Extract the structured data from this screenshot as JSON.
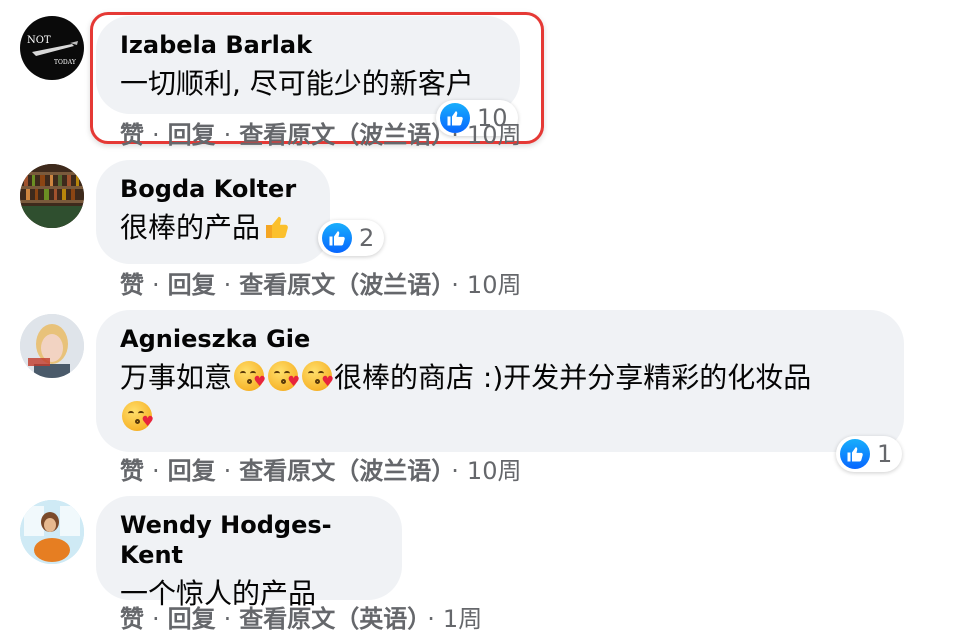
{
  "comments": [
    {
      "author": "Izabela Barlak",
      "text": "一切顺利, 尽可能少的新客户",
      "reaction_count": "10",
      "actions": {
        "like": "赞",
        "reply": "回复",
        "see_original": "查看原文（波兰语）",
        "time": "10周"
      },
      "avatar_lines": [
        "NOT",
        "TODAY"
      ]
    },
    {
      "author": "Bogda Kolter",
      "text": "很棒的产品",
      "reaction_count": "2",
      "actions": {
        "like": "赞",
        "reply": "回复",
        "see_original": "查看原文（波兰语）",
        "time": "10周"
      }
    },
    {
      "author": "Agnieszka Gie",
      "text_part1": "万事如意",
      "text_part2": "很棒的商店 :)开发并分享精彩的化妆品",
      "reaction_count": "1",
      "actions": {
        "like": "赞",
        "reply": "回复",
        "see_original": "查看原文（波兰语）",
        "time": "10周"
      }
    },
    {
      "author": "Wendy Hodges-Kent",
      "text": "一个惊人的产品",
      "actions": {
        "like": "赞",
        "reply": "回复",
        "see_original": "查看原文（英语）",
        "time": "1周"
      }
    }
  ],
  "separator": "·",
  "colors": {
    "like_blue": "#0866ff",
    "highlight_red": "#e53935",
    "bubble_bg": "#f0f2f5",
    "meta_gray": "#65676b"
  },
  "icons": {
    "reaction": "thumbs-up-icon",
    "emoji_thumb": "thumbs-up-emoji",
    "emoji_kiss": "face-blowing-kiss-emoji"
  }
}
